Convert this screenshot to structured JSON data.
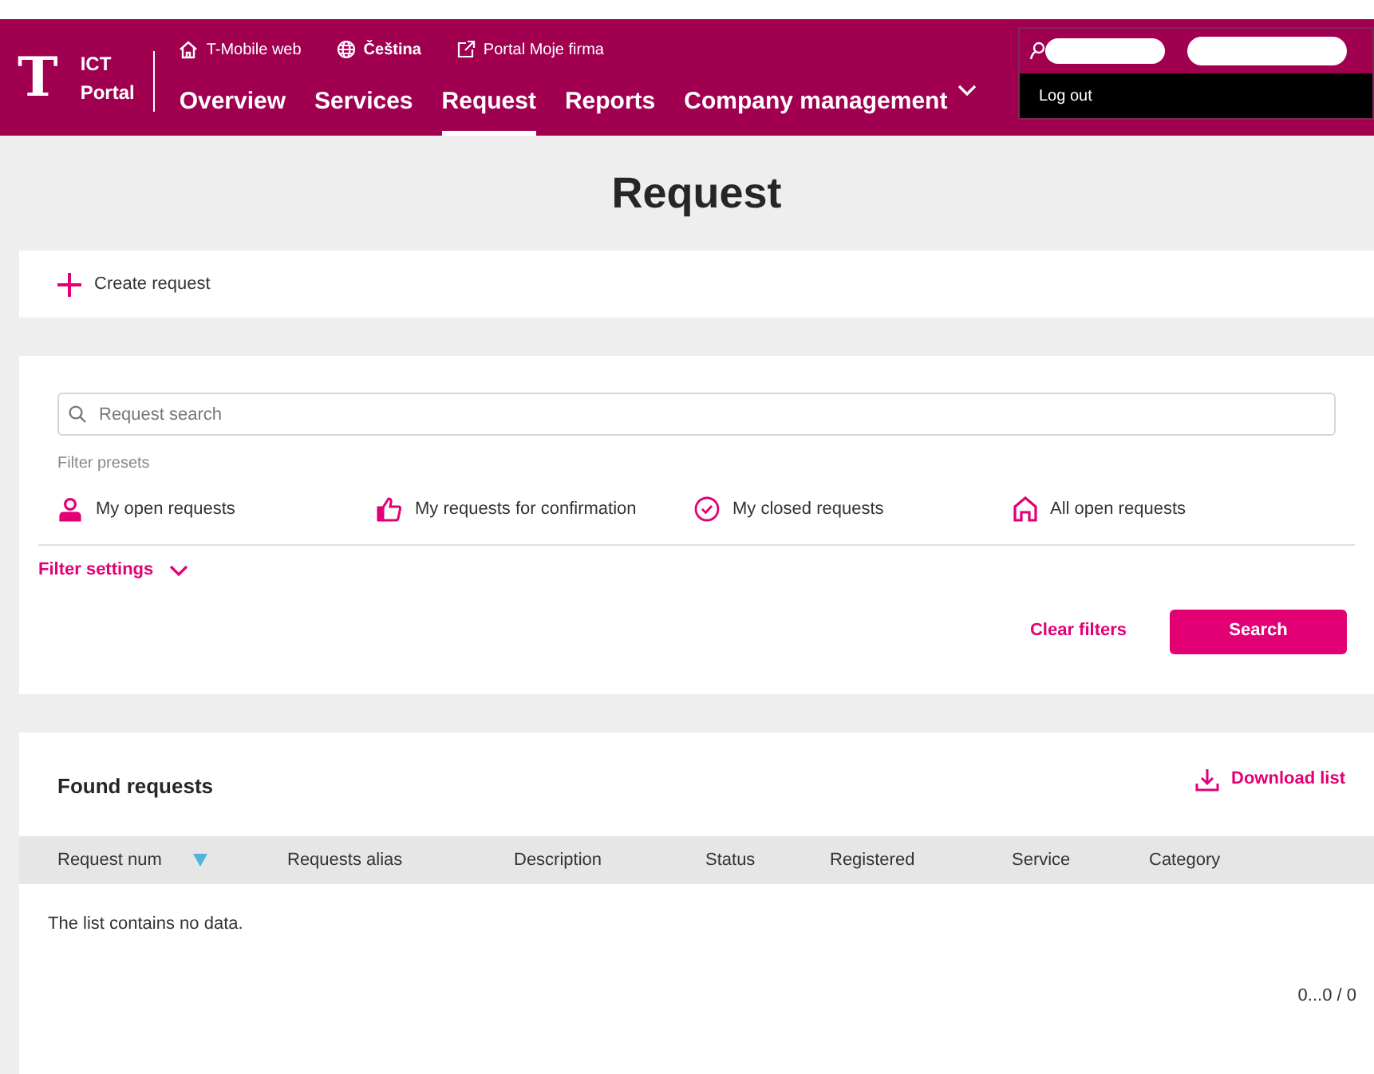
{
  "header": {
    "logo_letter": "T",
    "logo_line1": "ICT",
    "logo_line2": "Portal",
    "top_links": [
      {
        "kind": "home",
        "label": "T-Mobile web",
        "bold": false
      },
      {
        "kind": "globe",
        "label": "Čeština",
        "bold": true
      },
      {
        "kind": "external",
        "label": "Portal Moje firma",
        "bold": false
      }
    ],
    "nav": [
      {
        "label": "Overview",
        "selected": false,
        "dropdown": false
      },
      {
        "label": "Services",
        "selected": false,
        "dropdown": false
      },
      {
        "label": "Request",
        "selected": true,
        "dropdown": false
      },
      {
        "label": "Reports",
        "selected": false,
        "dropdown": false
      },
      {
        "label": "Company management",
        "selected": false,
        "dropdown": true
      }
    ],
    "user_menu": {
      "logout": "Log out"
    }
  },
  "page_title": "Request",
  "create_request": "Create request",
  "filters": {
    "search_placeholder": "Request search",
    "presets_label": "Filter presets",
    "presets": [
      {
        "kind": "person",
        "label": "My open requests"
      },
      {
        "kind": "thumb",
        "label": "My requests for confirmation"
      },
      {
        "kind": "check",
        "label": "My closed requests"
      },
      {
        "kind": "home",
        "label": "All open requests"
      }
    ],
    "settings": "Filter settings",
    "clear": "Clear filters",
    "search": "Search"
  },
  "results": {
    "title": "Found requests",
    "download": "Download list",
    "columns": [
      {
        "label": "Request num",
        "sorted": true
      },
      {
        "label": "Requests alias",
        "sorted": false
      },
      {
        "label": "Description",
        "sorted": false
      },
      {
        "label": "Status",
        "sorted": false
      },
      {
        "label": "Registered",
        "sorted": false
      },
      {
        "label": "Service",
        "sorted": false
      },
      {
        "label": "Category",
        "sorted": false
      }
    ],
    "empty": "The list contains no data.",
    "pagination": "0...0 / 0"
  }
}
